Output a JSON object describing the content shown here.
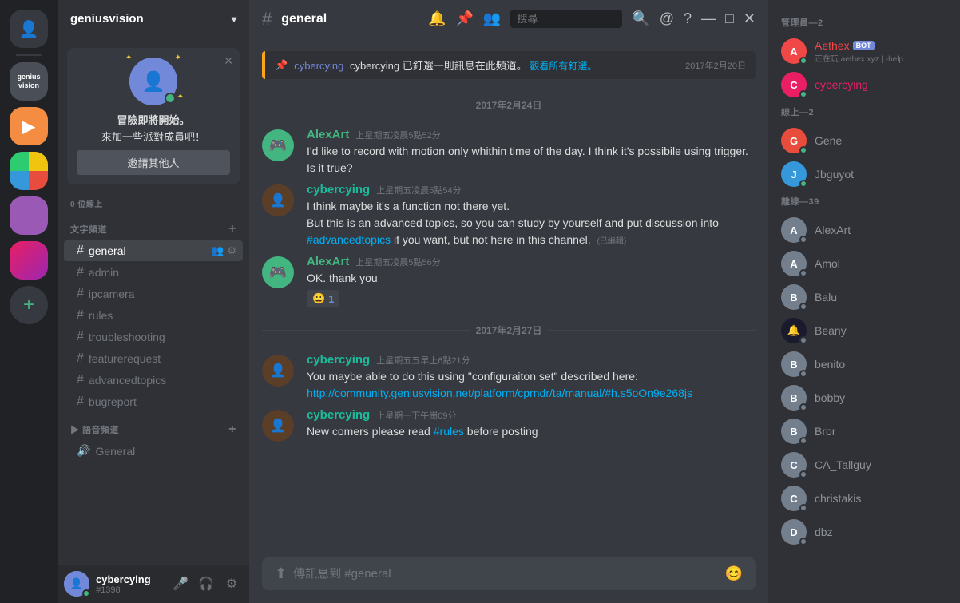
{
  "server": {
    "name": "geniusvision",
    "dropdown_arrow": "▾"
  },
  "user_card": {
    "close": "✕",
    "online_count": "0 位線上",
    "welcome_text": "冒險即將開始。",
    "sub_text": "來加一些派對成員吧！",
    "invite_btn": "邀請其他人"
  },
  "channels": {
    "text_section": "文字頻道",
    "add_icon": "+",
    "items": [
      {
        "name": "general",
        "active": true
      },
      {
        "name": "admin"
      },
      {
        "name": "ipcamera"
      },
      {
        "name": "rules"
      },
      {
        "name": "troubleshooting"
      },
      {
        "name": "featurerequest"
      },
      {
        "name": "advancedtopics"
      },
      {
        "name": "bugreport"
      }
    ],
    "voice_section": "語音頻道",
    "voice_items": [
      {
        "name": "General"
      }
    ]
  },
  "current_user": {
    "name": "cybercying",
    "tag": "#1398"
  },
  "chat": {
    "channel": "general",
    "hash": "#",
    "search_placeholder": "搜尋"
  },
  "pinned": {
    "text": "cybercying 已釘選一則訊息在此頻道。",
    "view_all": "觀看所有釘選。",
    "date": "2017年2月20日"
  },
  "date_dividers": {
    "feb24": "2017年2月24日",
    "feb27": "2017年2月27日"
  },
  "messages": [
    {
      "id": "m1",
      "author": "AlexArt",
      "author_color": "green",
      "timestamp": "上星期五凌晨5點52分",
      "text": "I'd like to record with motion only whithin time of the day. I think it's possibile using trigger. Is it true?"
    },
    {
      "id": "m2",
      "author": "cybercying",
      "author_color": "teal",
      "timestamp": "上星期五凌晨5點54分",
      "text1": "I think maybe it's a function not there yet.",
      "text2": "But this is an advanced topics, so you can study by yourself and put discussion into",
      "hashtag": "#advancedtopics",
      "text3": "if you want, but not here in this channel.",
      "edited": "(已編輯)",
      "has_actions": true
    },
    {
      "id": "m3",
      "author": "AlexArt",
      "author_color": "green",
      "timestamp": "上星期五凌晨5點56分",
      "text": "OK. thank you",
      "reaction_emoji": "😀",
      "reaction_count": "1"
    },
    {
      "id": "m4",
      "author": "cybercying",
      "author_color": "teal",
      "timestamp": "上星期五五早上6點21分",
      "text": "You maybe able to do this using \"configuraiton set\" described here:",
      "link": "http://community.geniusvision.net/platform/cprndr/ta/manual/#h.s5oOn9e268js"
    },
    {
      "id": "m5",
      "author": "cybercying",
      "author_color": "teal",
      "timestamp": "上星期一下午崗09分",
      "text1": "New comers please read",
      "hashtag": "#rules",
      "text2": "before posting"
    }
  ],
  "message_input": {
    "placeholder": "傳訊息到 #general"
  },
  "members": {
    "admin_header": "管理員—2",
    "online_header": "線上—2",
    "offline_header": "離線—39",
    "admins": [
      {
        "name": "Aethex",
        "bot": true,
        "status": "online",
        "sub": "正在玩 aethex.xyz | -help"
      },
      {
        "name": "cybercying",
        "bot": false,
        "status": "online"
      }
    ],
    "online": [
      {
        "name": "Gene",
        "status": "online"
      },
      {
        "name": "Jbguyot",
        "status": "online"
      }
    ],
    "offline": [
      {
        "name": "AlexArt"
      },
      {
        "name": "Amol"
      },
      {
        "name": "Balu"
      },
      {
        "name": "Beany"
      },
      {
        "name": "benito"
      },
      {
        "name": "bobby"
      },
      {
        "name": "Bror"
      },
      {
        "name": "CA_Tallguy"
      },
      {
        "name": "christakis"
      },
      {
        "name": "dbz"
      }
    ]
  },
  "pinned_link_url": "http://community.geniusvision.net/platform/cprndr/ta/cpmanual/entry-h.b395ibknk3fg.html"
}
